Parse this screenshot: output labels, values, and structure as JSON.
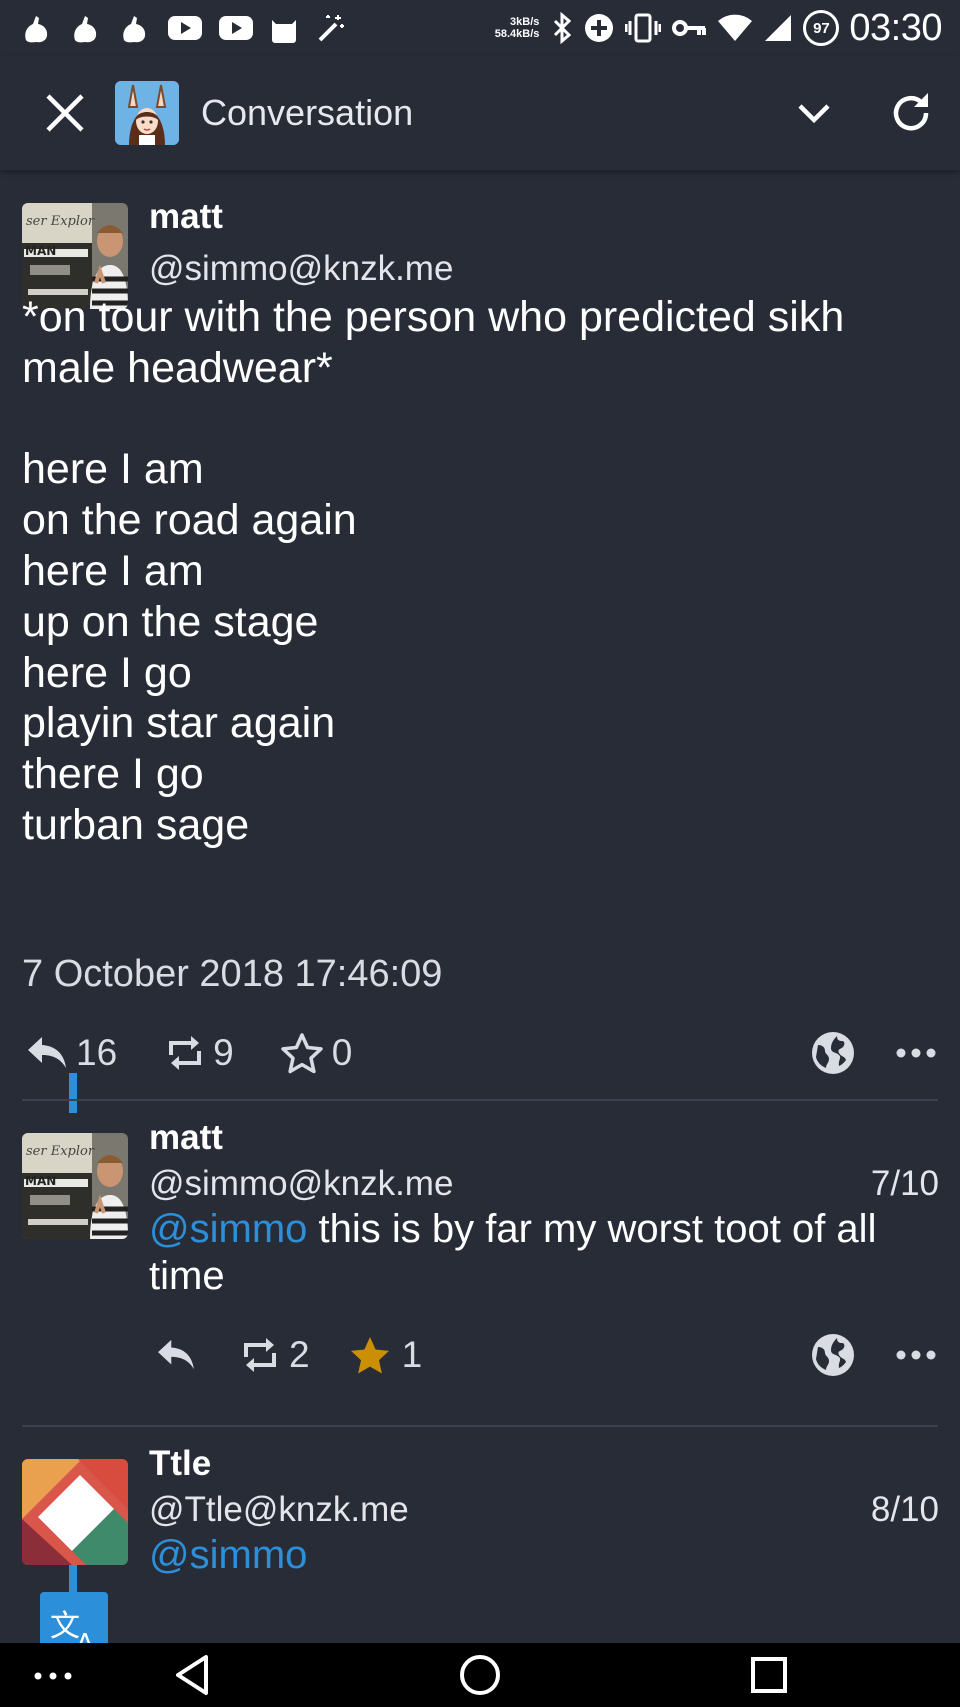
{
  "status_bar": {
    "net_up": "3kB/s",
    "net_down": "58.4kB/s",
    "battery": "97",
    "time": "03:30"
  },
  "header": {
    "title": "Conversation"
  },
  "main_toot": {
    "name": "matt",
    "acct": "@simmo@knzk.me",
    "content_lines": [
      "*on tour with the person who predicted sikh",
      "male headwear*",
      "",
      "here I am",
      "on the road again",
      "here I am",
      "up on the stage",
      "here I go",
      "playin star again",
      "there I go",
      "turban sage"
    ],
    "timestamp": "7 October 2018 17:46:09",
    "replies": "16",
    "boosts": "9",
    "favourites": "0"
  },
  "replies": [
    {
      "name": "matt",
      "acct": "@simmo@knzk.me",
      "date": "7/10",
      "mention": "@simmo",
      "text_line1": " this is by far my worst toot of all",
      "text_line2": "time",
      "boosts": "2",
      "favourites": "1"
    },
    {
      "name": "Ttle",
      "acct": "@Ttle@knzk.me",
      "date": "8/10",
      "mention": "@simmo"
    }
  ],
  "colors": {
    "background": "#282c37",
    "accent": "#2b90d9",
    "favourite": "#ca8f04"
  },
  "icons": [
    "close-icon",
    "chevron-down-icon",
    "refresh-icon",
    "reply-icon",
    "boost-icon",
    "star-icon",
    "globe-icon",
    "more-icon",
    "translate-icon"
  ]
}
